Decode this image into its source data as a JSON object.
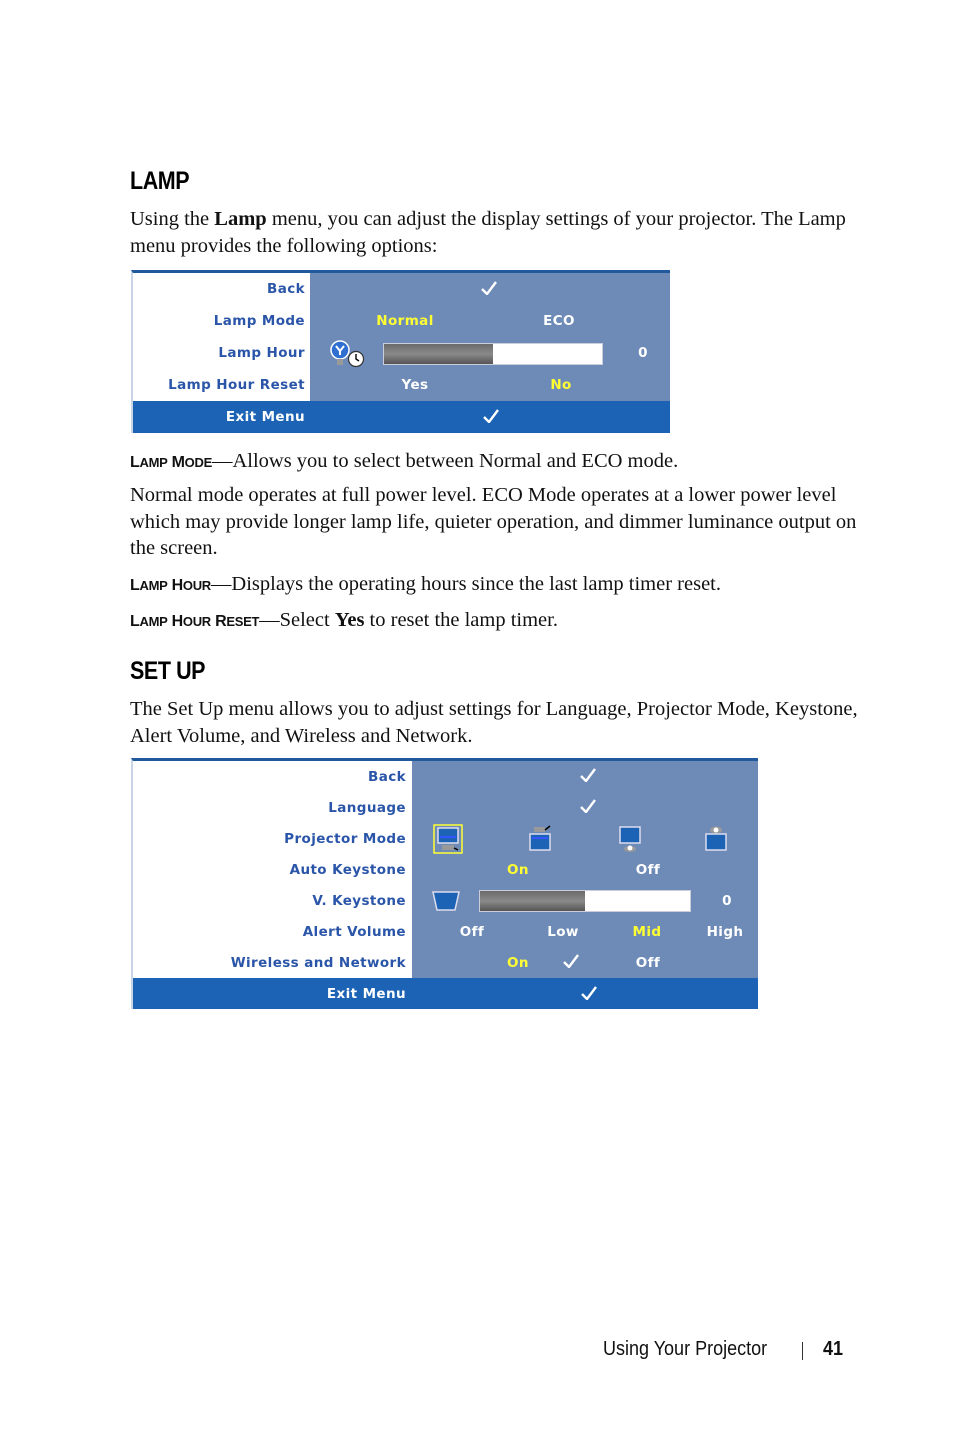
{
  "lamp_section": {
    "heading": "LAMP",
    "intro_pre": "Using the ",
    "intro_bold": "Lamp",
    "intro_post": " menu, you can adjust the display settings of your projector. The Lamp menu provides the following options:",
    "osd": {
      "rows": [
        {
          "label": "Back",
          "value_icon": "check-icon"
        },
        {
          "label": "Lamp Mode",
          "options": [
            "Normal",
            "ECO"
          ],
          "selected": "Normal"
        },
        {
          "label": "Lamp Hour",
          "icon": "lamp-clock-icon",
          "progress_fraction": 0.5,
          "value": "0"
        },
        {
          "label": "Lamp Hour Reset",
          "options": [
            "Yes",
            "No"
          ],
          "selected": "No"
        }
      ],
      "exit_label": "Exit Menu"
    },
    "lamp_mode_term_cap1": "L",
    "lamp_mode_term_rest1": "AMP",
    "lamp_mode_term_cap2": "M",
    "lamp_mode_term_rest2": "ODE",
    "lamp_mode_desc": "—Allows you to select between Normal and ECO mode.",
    "normal_mode_para": "Normal mode operates at full power level. ECO Mode operates at a lower power level which may provide longer lamp life, quieter operation, and dimmer luminance output on the screen.",
    "lamp_hour_term_cap2": "H",
    "lamp_hour_term_rest2": "OUR",
    "lamp_hour_desc": "—Displays the operating hours since the last lamp timer reset.",
    "lamp_reset_term_cap3": "R",
    "lamp_reset_term_rest3": "ESET",
    "lamp_reset_desc_pre": "—Select ",
    "lamp_reset_desc_bold": "Yes",
    "lamp_reset_desc_post": " to reset the lamp timer."
  },
  "setup_section": {
    "heading": "SET UP",
    "intro": "The Set Up menu allows you to adjust settings for Language, Projector Mode, Keystone, Alert Volume, and Wireless and Network.",
    "osd": {
      "rows": [
        {
          "label": "Back",
          "value_icon": "check-icon"
        },
        {
          "label": "Language",
          "value_icon": "check-icon"
        },
        {
          "label": "Projector Mode",
          "icons": [
            "front-projection-desktop-icon",
            "front-projection-ceiling-icon",
            "rear-projection-desktop-icon",
            "rear-projection-ceiling-icon"
          ],
          "selected_index": 0
        },
        {
          "label": "Auto Keystone",
          "options": [
            "On",
            "Off"
          ],
          "selected": "On"
        },
        {
          "label": "V. Keystone",
          "icon": "keystone-trapezoid-icon",
          "progress_fraction": 0.5,
          "value": "0"
        },
        {
          "label": "Alert Volume",
          "options": [
            "Off",
            "Low",
            "Mid",
            "High"
          ],
          "selected": "Mid"
        },
        {
          "label": "Wireless and Network",
          "options": [
            "On",
            "Off"
          ],
          "selected": "On"
        }
      ],
      "exit_label": "Exit Menu"
    }
  },
  "footer": {
    "section_title": "Using Your Projector",
    "page_number": "41"
  },
  "colors": {
    "osd_panel": "#6e8bb7",
    "osd_exit_bar": "#1d63b5",
    "osd_label": "#2a55a8",
    "osd_selected": "#ffff33"
  }
}
